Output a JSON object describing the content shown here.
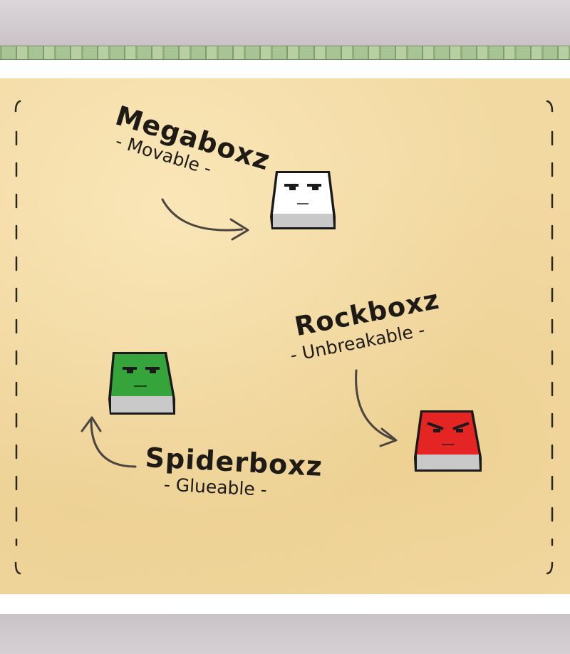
{
  "blocks": [
    {
      "name": "Megaboxz",
      "ability": "- Movable -",
      "color": "#ffffff",
      "icon": "white-box-character"
    },
    {
      "name": "Rockboxz",
      "ability": "- Unbreakable -",
      "color": "#e52424",
      "icon": "red-box-character"
    },
    {
      "name": "Spiderboxz",
      "ability": "- Glueable -",
      "color": "#35a43b",
      "icon": "green-box-character"
    }
  ],
  "colors": {
    "paper": "#f2d9a2",
    "ink": "#1e1a16",
    "arrow": "#4a4540"
  }
}
